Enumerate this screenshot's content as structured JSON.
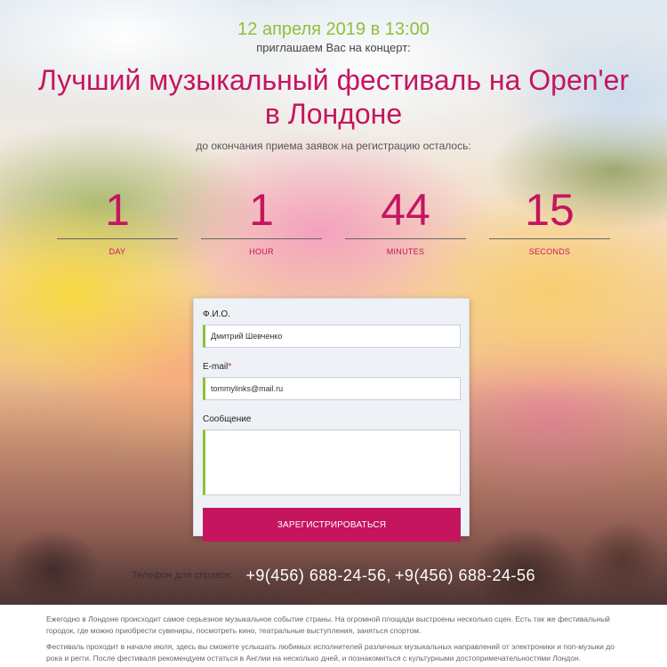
{
  "event": {
    "date": "12 апреля 2019 в 13:00",
    "invite": "приглашаем Вас на концерт:",
    "title_line1": "Лучший музыкальный фестиваль на Open'er",
    "title_line2": "в Лондоне",
    "countdown_caption": "до окончания приема заявок на регистрацию осталось:"
  },
  "countdown": [
    {
      "value": "1",
      "label": "DAY"
    },
    {
      "value": "1",
      "label": "HOUR"
    },
    {
      "value": "44",
      "label": "MINUTES"
    },
    {
      "value": "15",
      "label": "SECONDS"
    }
  ],
  "form": {
    "name_label": "Ф.И.О.",
    "name_value": "Дмитрий Шевченко",
    "email_label": "E-mail",
    "email_required": "*",
    "email_value": "tommylinks@mail.ru",
    "message_label": "Сообщение",
    "message_value": "",
    "submit_label": "ЗАРЕГИСТРИРОВАТЬСЯ"
  },
  "contacts": {
    "phone_label": "Телефон для справок:",
    "phone1": "+9(456) 688-24-56",
    "separator": ",",
    "phone2": "+9(456) 688-24-56"
  },
  "info": {
    "p1": "Ежегодно в Лондоне происходит самое серьезное музыкальное событие страны. На огромной площади выстроены несколько сцен. Есть так же фестивальный городок, где можно приобрести сувениры, посмотреть кино, театральные выступления, заняться спортом.",
    "p2": "Фестиваль проходит в начале июля, здесь вы сможете услышать любимых исполнителей различных музыкальных направлений от электроники и поп-музыки до рока и регги. После фестиваля рекомендуем остаться в Англии на несколько дней, и познакомиться с культурными достопримечательностями Лондон."
  },
  "colors": {
    "accent": "#c5155f",
    "date_green": "#8fbf3a"
  }
}
